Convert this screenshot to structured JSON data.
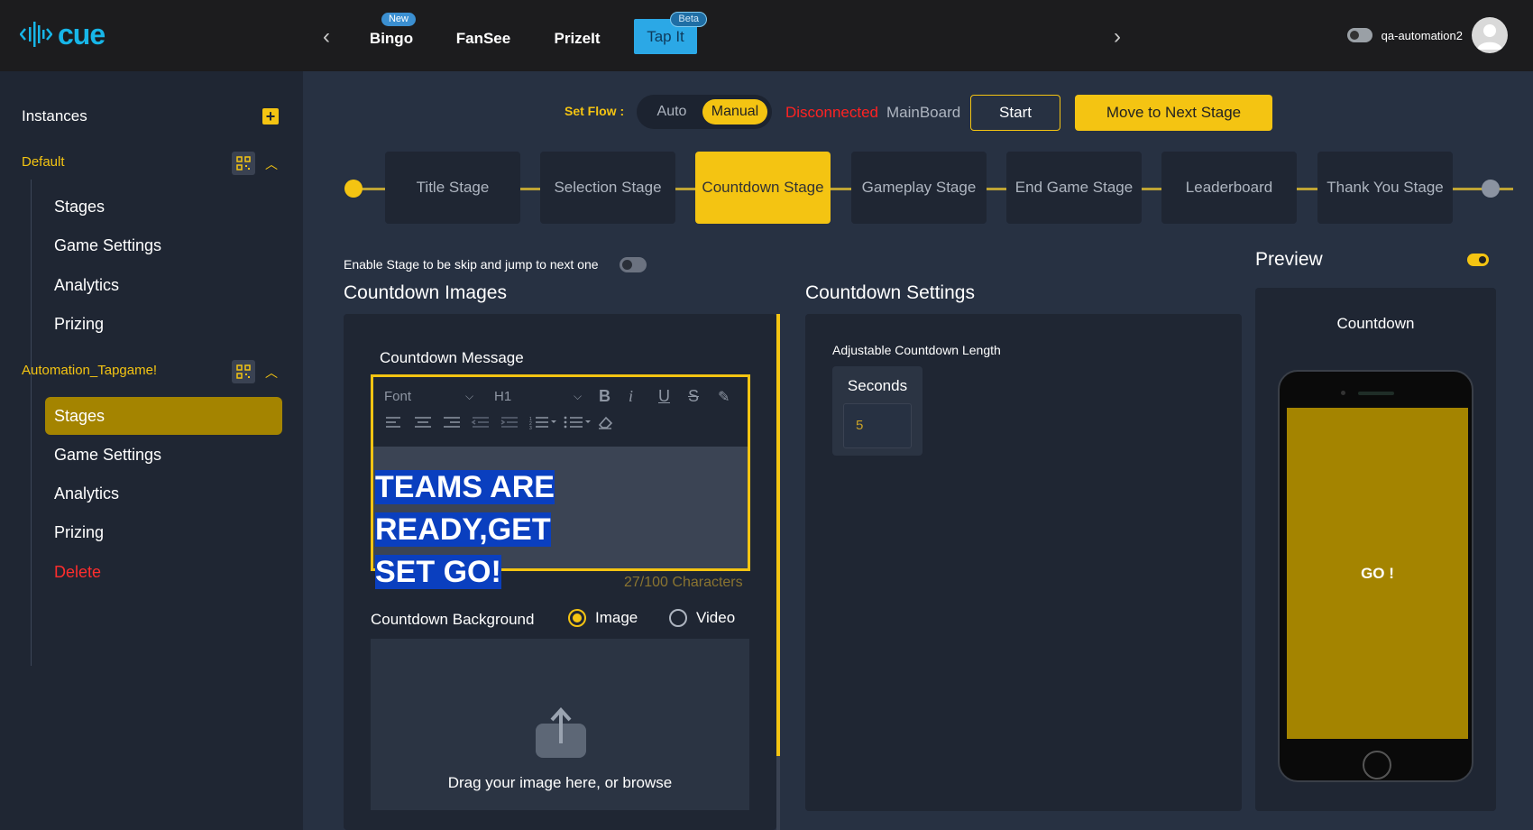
{
  "app": {
    "brand": "cue",
    "accent": "#f4c412",
    "brand_color": "#17b6e8"
  },
  "topnav": {
    "tabs": [
      {
        "label": "Bingo",
        "badge": "New"
      },
      {
        "label": "FanSee",
        "badge": ""
      },
      {
        "label": "PrizeIt",
        "badge": ""
      },
      {
        "label": "Tap It",
        "badge": "Beta"
      }
    ],
    "prev_icon": "chevron-left-icon",
    "next_icon": "chevron-right-icon",
    "username": "qa-automation2"
  },
  "sidebar": {
    "title": "Instances",
    "instances": [
      {
        "name": "Default",
        "items": [
          "Stages",
          "Game Settings",
          "Analytics",
          "Prizing"
        ]
      },
      {
        "name": "Automation_Tapgame!",
        "items": [
          "Stages",
          "Game Settings",
          "Analytics",
          "Prizing",
          "Delete"
        ],
        "active_item": "Stages"
      }
    ]
  },
  "flow": {
    "label": "Set Flow :",
    "options": [
      "Auto",
      "Manual"
    ],
    "selected": "Manual",
    "status": "Disconnected",
    "board": "MainBoard",
    "start_label": "Start",
    "next_label": "Move to Next Stage"
  },
  "stages": [
    "Title Stage",
    "Selection Stage",
    "Countdown Stage",
    "Gameplay Stage",
    "End Game Stage",
    "Leaderboard",
    "Thank You Stage"
  ],
  "active_stage": "Countdown Stage",
  "skip": {
    "label": "Enable Stage to be skip and jump to next one"
  },
  "images": {
    "title": "Countdown Images",
    "message_label": "Countdown Message",
    "toolbar": {
      "font": "Font",
      "heading": "H1"
    },
    "message_line1": "TEAMS ARE READY,GET",
    "message_line2": "SET GO!",
    "char_count": "27/100 Characters",
    "background_label": "Countdown Background",
    "bg_options": [
      "Image",
      "Video"
    ],
    "bg_selected": "Image",
    "drop_text": "Drag your image here, or browse"
  },
  "settings": {
    "title": "Countdown Settings",
    "length_label": "Adjustable Countdown Length",
    "unit": "Seconds",
    "value": "5"
  },
  "preview": {
    "title": "Preview",
    "screen_title": "Countdown",
    "screen_text": "GO !"
  }
}
